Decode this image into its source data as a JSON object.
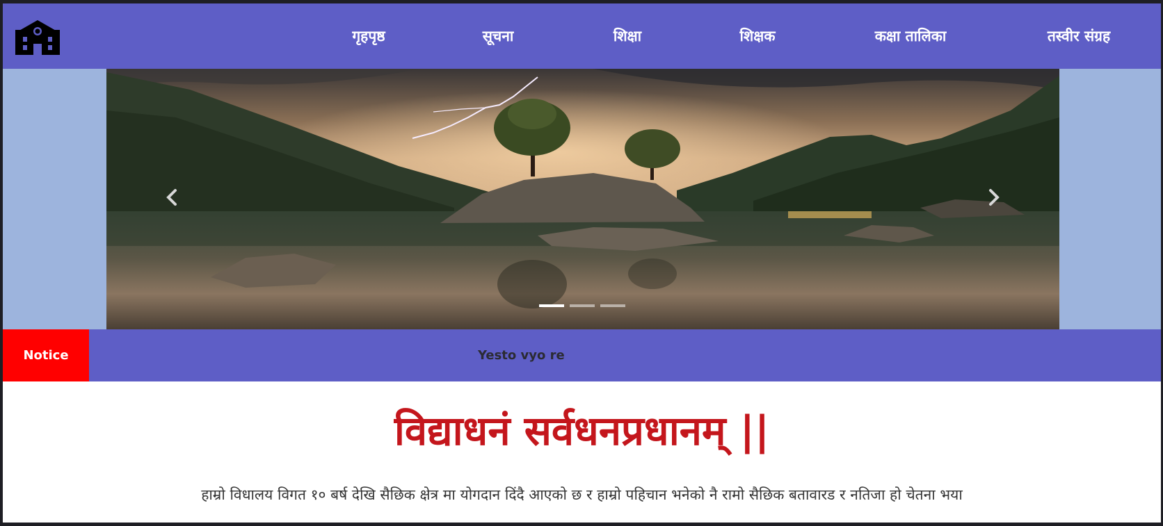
{
  "nav": {
    "logo_icon": "school-building-icon",
    "links": [
      {
        "label": "गृहपृष्ठ"
      },
      {
        "label": "सूचना"
      },
      {
        "label": "शिक्षा"
      },
      {
        "label": "शिक्षक"
      },
      {
        "label": "कक्षा तालिका"
      },
      {
        "label": "तस्वीर संग्रह"
      }
    ]
  },
  "carousel": {
    "prev_icon": "chevron-left-icon",
    "next_icon": "chevron-right-icon",
    "slide_count": 3,
    "active_slide": 1
  },
  "notice": {
    "label": "Notice",
    "text": "Yesto vyo re"
  },
  "main": {
    "motto": "विद्याधनं सर्वधनप्रधानम् ||",
    "description": "हाम्रो विधालय विगत १० बर्ष देखि सैछिक क्षेत्र मा योगदान दिंदै आएको छ र हाम्रो पहिचान भनेको नै रामो सैछिक बतावारड र नतिजा हो चेतना भया"
  },
  "colors": {
    "nav_bg": "#5e5ec6",
    "hero_bg": "#9db4dd",
    "notice_label_bg": "#ff0000",
    "motto_color": "#c4161c"
  }
}
